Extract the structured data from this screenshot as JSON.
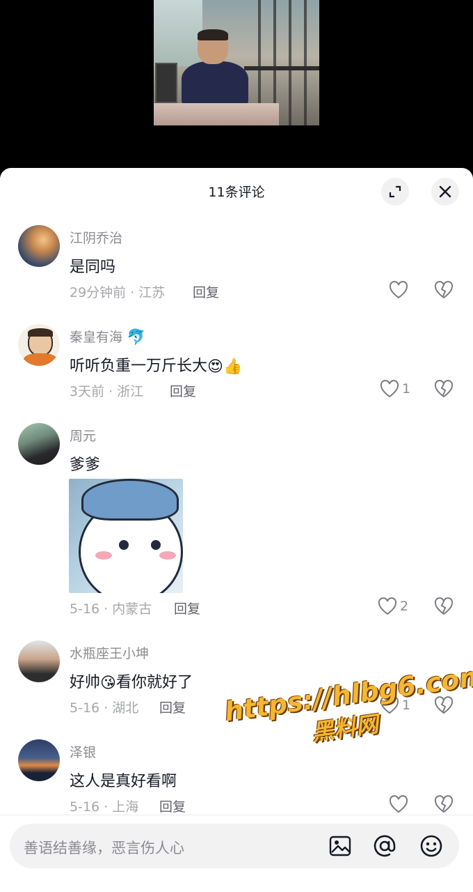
{
  "header": {
    "title": "11条评论"
  },
  "comments": [
    {
      "user": "江阴乔治",
      "text": "是同吗",
      "meta": "29分钟前 · 江苏",
      "reply": "回复",
      "likes": ""
    },
    {
      "user": "秦皇有海",
      "user_emoji": "🐬",
      "text": "听听负重一万斤长大",
      "text_emojis": "😍👍",
      "meta": "3天前 · 浙江",
      "reply": "回复",
      "likes": "1"
    },
    {
      "user": "周元",
      "text": "爹爹",
      "meta": "5-16 · 内蒙古",
      "reply": "回复",
      "likes": "2"
    },
    {
      "user": "水瓶座王小坤",
      "text_a": "好帅",
      "text_emoji": "😘",
      "text_b": "看你就好了",
      "meta": "5-16 · 湖北",
      "reply": "回复",
      "likes": "1"
    },
    {
      "user": "泽银",
      "text": "这人是真好看啊",
      "meta": "5-16 · 上海",
      "reply": "回复",
      "likes": ""
    }
  ],
  "input": {
    "placeholder": "善语结善缘，恶言伤人心"
  },
  "watermark": {
    "line1": "https://hlbg6.com",
    "line2": "黑料网"
  },
  "colors": {
    "accent_watermark": "#f5b632",
    "text_primary": "#161823",
    "text_secondary": "#8a8b91"
  },
  "icons": [
    "expand-icon",
    "close-icon",
    "heart-icon",
    "broken-heart-icon",
    "image-icon",
    "at-icon",
    "emoji-icon"
  ]
}
